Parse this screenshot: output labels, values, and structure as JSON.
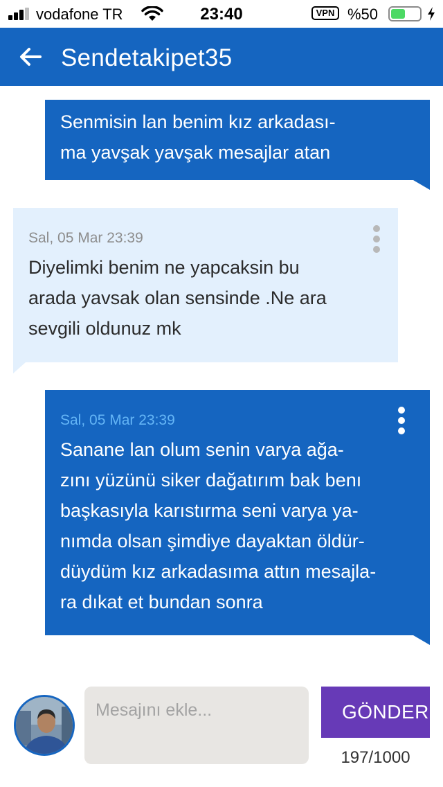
{
  "status_bar": {
    "carrier": "vodafone TR",
    "time": "23:40",
    "vpn": "VPN",
    "battery_percent": "%50",
    "battery_level": 0.5,
    "icons": [
      "signal-icon",
      "wifi-icon",
      "vpn-icon",
      "battery-icon",
      "charging-bolt-icon"
    ]
  },
  "header": {
    "title": "Sendetakipet35",
    "back_icon": "arrow-left-icon"
  },
  "messages": [
    {
      "direction": "outgoing",
      "date": "",
      "text": "Senmisin lan benim kız arkadası-\nma yavşak yavşak mesajlar atan"
    },
    {
      "direction": "incoming",
      "date": "Sal, 05 Mar 23:39",
      "text": "Diyelimki benim ne yapcaksin bu\narada yavsak olan sensinde .Ne ara\nsevgili oldunuz mk"
    },
    {
      "direction": "outgoing",
      "date": "Sal, 05 Mar 23:39",
      "text": "Sanane lan olum senin varya ağa-\nzını yüzünü siker dağatırım bak benı\nbaşkasıyla karıstırma seni varya ya-\nnımda olsan şimdiye dayaktan öldür-\ndüydüm kız arkadasıma attın mesajla-\nra dıkat et bundan sonra"
    }
  ],
  "composer": {
    "placeholder": "Mesajını ekle...",
    "value": "",
    "send_label": "GÖNDER",
    "char_count": "197/1000",
    "avatar": "user-avatar"
  },
  "colors": {
    "primary": "#1565c0",
    "incoming_bubble": "#e3f0fd",
    "send_button": "#673ab7",
    "battery": "#4cd964"
  }
}
